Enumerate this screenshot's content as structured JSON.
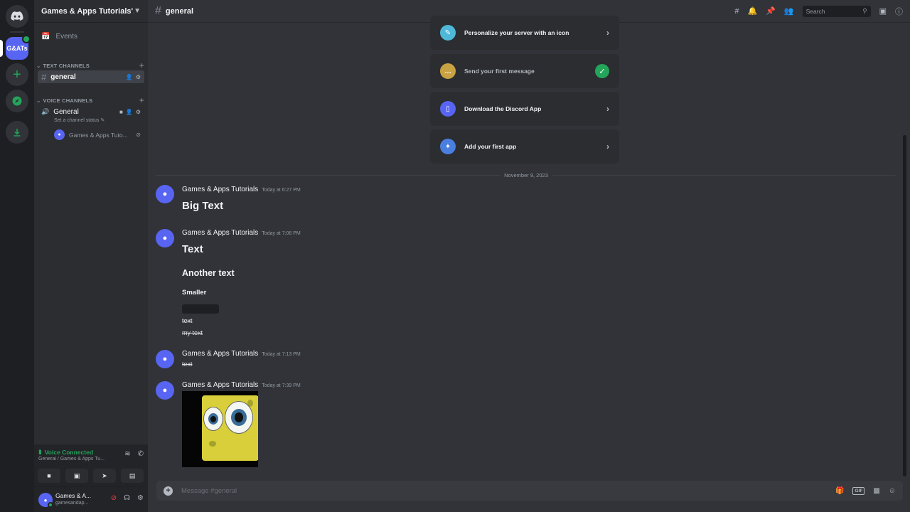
{
  "server": {
    "name": "Games & Apps Tutorials'...",
    "short": "G&ATs"
  },
  "sidebar": {
    "events_label": "Events",
    "text_category": "Text Channels",
    "voice_category": "Voice Channels",
    "text_channels": [
      {
        "name": "general"
      }
    ],
    "voice_channels": [
      {
        "name": "General",
        "status_placeholder": "Set a channel status"
      }
    ],
    "voice_user": "Games & Apps Tuto..."
  },
  "voice_panel": {
    "title": "Voice Connected",
    "subtitle": "General / Games & Apps Tu..."
  },
  "user_panel": {
    "name": "Games & A...",
    "tag": "gamesandap..."
  },
  "topbar": {
    "channel": "general",
    "search_placeholder": "Search"
  },
  "onboarding": [
    {
      "label": "Personalize your server with an icon",
      "done": false
    },
    {
      "label": "Send your first message",
      "done": true
    },
    {
      "label": "Download the Discord App",
      "done": false
    },
    {
      "label": "Add your first app",
      "done": false
    }
  ],
  "date_divider": "November 9, 2023",
  "messages": [
    {
      "author": "Games & Apps Tutorials",
      "time": "Today at 6:27 PM",
      "lines": [
        "Big Text"
      ]
    },
    {
      "author": "Games & Apps Tutorials",
      "time": "Today at 7:06 PM",
      "lines": [
        "Text",
        "Another text",
        "Smaller",
        "text",
        "my text"
      ]
    },
    {
      "author": "Games & Apps Tutorials",
      "time": "Today at 7:13 PM",
      "lines": [
        "text"
      ]
    },
    {
      "author": "Games & Apps Tutorials",
      "time": "Today at 7:39 PM",
      "lines": []
    }
  ],
  "composer": {
    "placeholder": "Message #general"
  },
  "colors": {
    "blurple": "#5865f2",
    "green": "#23a55a",
    "background": "#313338"
  }
}
